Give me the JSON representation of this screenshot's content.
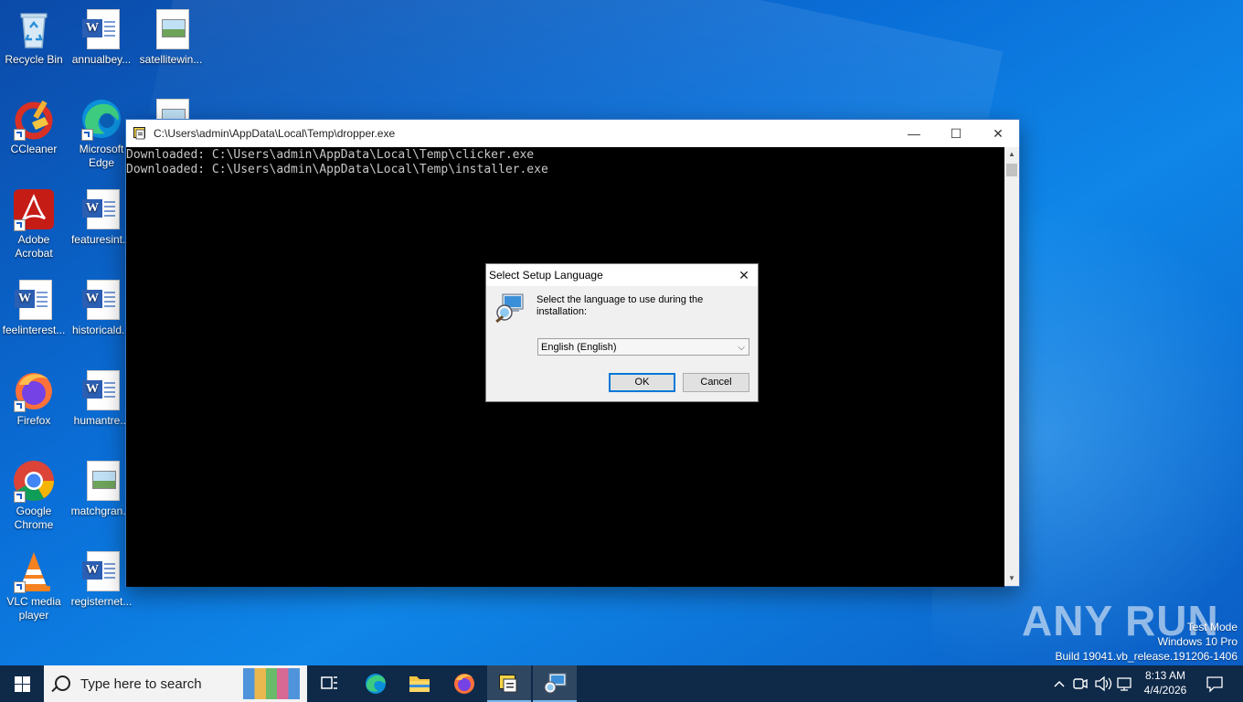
{
  "desktop": {
    "icons": [
      {
        "label": "Recycle Bin",
        "icon": "recycle-bin-icon"
      },
      {
        "label": "annualbey...",
        "icon": "word-document-icon"
      },
      {
        "label": "satellitewin...",
        "icon": "image-file-icon"
      },
      {
        "label": "CCleaner",
        "icon": "ccleaner-icon"
      },
      {
        "label": "Microsoft Edge",
        "icon": "edge-icon"
      },
      {
        "label": "Adobe Acrobat",
        "icon": "acrobat-icon"
      },
      {
        "label": "featuresint...",
        "icon": "word-document-icon"
      },
      {
        "label": "feelinterest...",
        "icon": "word-document-icon"
      },
      {
        "label": "historicald...",
        "icon": "word-document-icon"
      },
      {
        "label": "Firefox",
        "icon": "firefox-icon"
      },
      {
        "label": "humantre...",
        "icon": "word-document-icon"
      },
      {
        "label": "Google Chrome",
        "icon": "chrome-icon"
      },
      {
        "label": "matchgran...",
        "icon": "image-file-icon"
      },
      {
        "label": "VLC media player",
        "icon": "vlc-icon"
      },
      {
        "label": "registernet...",
        "icon": "word-document-icon"
      }
    ]
  },
  "console": {
    "title": "C:\\Users\\admin\\AppData\\Local\\Temp\\dropper.exe",
    "lines": [
      "Downloaded: C:\\Users\\admin\\AppData\\Local\\Temp\\clicker.exe",
      "Downloaded: C:\\Users\\admin\\AppData\\Local\\Temp\\installer.exe"
    ],
    "minimize": "—",
    "maximize": "☐",
    "close": "✕"
  },
  "dialog": {
    "title": "Select Setup Language",
    "prompt": "Select the language to use during the installation:",
    "selected_language": "English (English)",
    "ok_label": "OK",
    "cancel_label": "Cancel",
    "close": "✕"
  },
  "watermark": {
    "brand": "ANY RUN",
    "test_mode": "Test Mode",
    "edition": "Windows 10 Pro",
    "build": "Build 19041.vb_release.191206-1406"
  },
  "taskbar": {
    "search_placeholder": "Type here to search",
    "time": "8:13 AM",
    "date": "4/4/2026"
  },
  "colors": {
    "taskbar": "#0f2948",
    "accent": "#0078d7",
    "desktop": "#0a6fd8"
  }
}
